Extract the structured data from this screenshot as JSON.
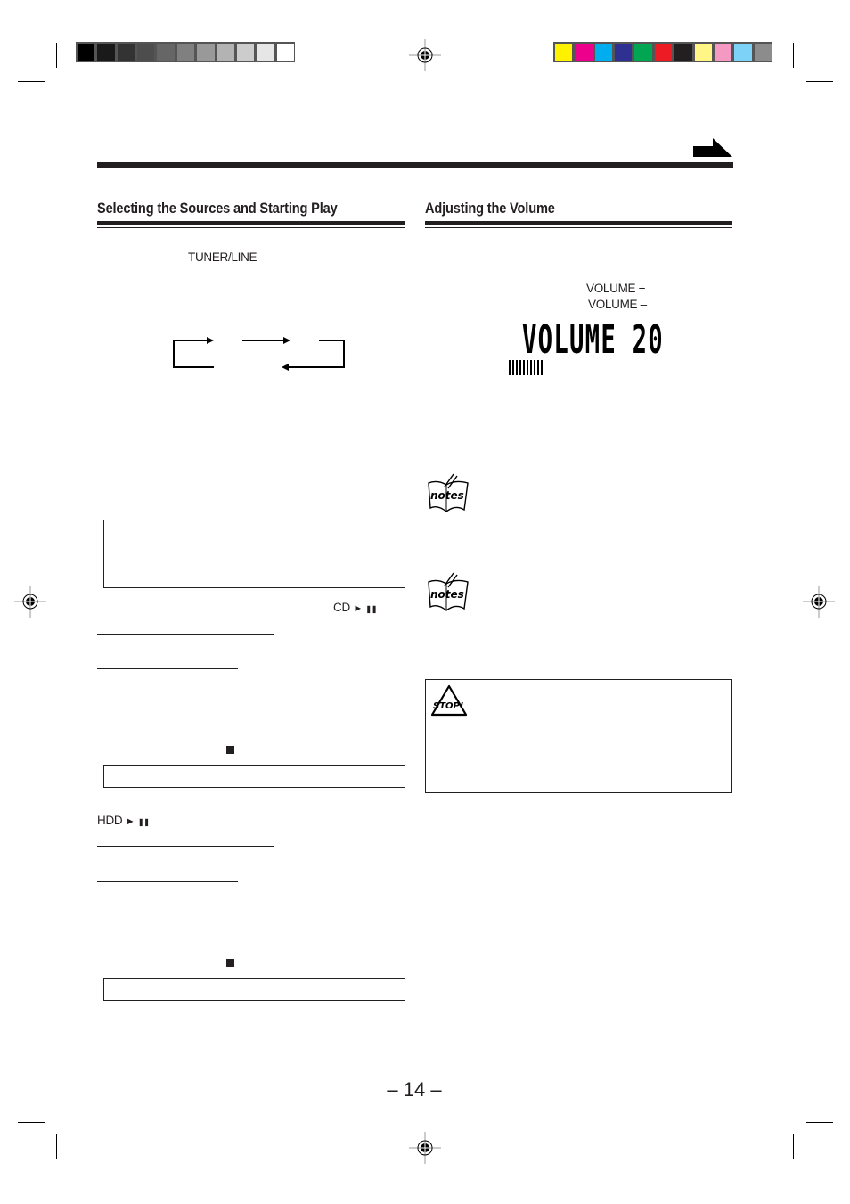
{
  "print_marks": {
    "grayscale_swatches": [
      "#000000",
      "#1a1a1a",
      "#333333",
      "#4d4d4d",
      "#666666",
      "#808080",
      "#999999",
      "#b3b3b3",
      "#cccccc",
      "#e6e6e6",
      "#ffffff"
    ],
    "color_swatches": [
      "#fff200",
      "#ec008c",
      "#00aeef",
      "#2e3192",
      "#00a651",
      "#ed1c24",
      "#231f20",
      "#fff685",
      "#f49ac2",
      "#7dd3f7",
      "#8c8c8c"
    ]
  },
  "left_section": {
    "title": "Selecting the Sources and Starting Play",
    "tuner_line_label": "TUNER/LINE",
    "cd_play_pause_label": "CD",
    "hdd_play_pause_label": "HDD",
    "play_symbol": "►",
    "pause_symbol": "❚❚",
    "stop_symbol": "■"
  },
  "right_section": {
    "title": "Adjusting the Volume",
    "volume_up_label": "VOLUME +",
    "volume_down_label": "VOLUME –",
    "display_text": "VOLUME 20",
    "display_level_bars": 10,
    "notes_icon_text": "notes",
    "stop_icon_text": "STOP!"
  },
  "footer": {
    "page_number": "– 14 –"
  }
}
